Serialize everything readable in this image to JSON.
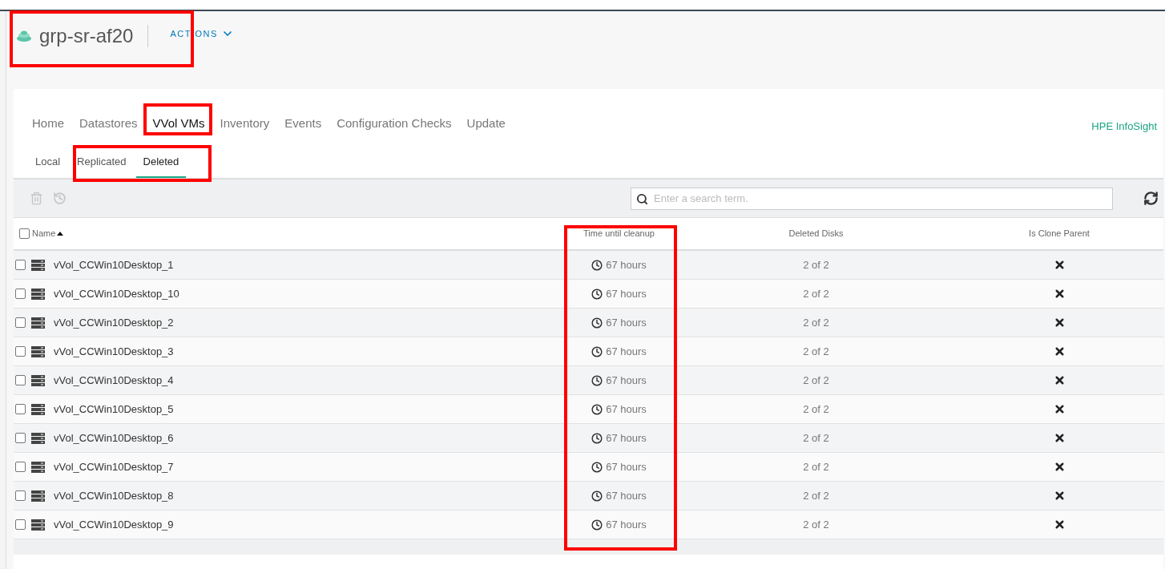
{
  "header": {
    "title": "grp-sr-af20",
    "actions": "ACTIONS"
  },
  "tabs": [
    {
      "label": "Home",
      "selected": false
    },
    {
      "label": "Datastores",
      "selected": false
    },
    {
      "label": "VVol VMs",
      "selected": true
    },
    {
      "label": "Inventory",
      "selected": false
    },
    {
      "label": "Events",
      "selected": false
    },
    {
      "label": "Configuration Checks",
      "selected": false
    },
    {
      "label": "Update",
      "selected": false
    }
  ],
  "infosight_link": "HPE InfoSight",
  "subtabs": [
    {
      "label": "Local",
      "selected": false
    },
    {
      "label": "Replicated",
      "selected": false
    },
    {
      "label": "Deleted",
      "selected": true
    }
  ],
  "search": {
    "placeholder": "Enter a search term."
  },
  "table": {
    "select_all_checked": false,
    "columns": [
      "Name",
      "Time until cleanup",
      "Deleted Disks",
      "Is Clone Parent"
    ],
    "rows": [
      {
        "name": "vVol_CCWin10Desktop_1",
        "time": "67 hours",
        "disks": "2 of 2",
        "is_clone_parent": false,
        "checked": false
      },
      {
        "name": "vVol_CCWin10Desktop_10",
        "time": "67 hours",
        "disks": "2 of 2",
        "is_clone_parent": false,
        "checked": false
      },
      {
        "name": "vVol_CCWin10Desktop_2",
        "time": "67 hours",
        "disks": "2 of 2",
        "is_clone_parent": false,
        "checked": false
      },
      {
        "name": "vVol_CCWin10Desktop_3",
        "time": "67 hours",
        "disks": "2 of 2",
        "is_clone_parent": false,
        "checked": false
      },
      {
        "name": "vVol_CCWin10Desktop_4",
        "time": "67 hours",
        "disks": "2 of 2",
        "is_clone_parent": false,
        "checked": false
      },
      {
        "name": "vVol_CCWin10Desktop_5",
        "time": "67 hours",
        "disks": "2 of 2",
        "is_clone_parent": false,
        "checked": false
      },
      {
        "name": "vVol_CCWin10Desktop_6",
        "time": "67 hours",
        "disks": "2 of 2",
        "is_clone_parent": false,
        "checked": false
      },
      {
        "name": "vVol_CCWin10Desktop_7",
        "time": "67 hours",
        "disks": "2 of 2",
        "is_clone_parent": false,
        "checked": false
      },
      {
        "name": "vVol_CCWin10Desktop_8",
        "time": "67 hours",
        "disks": "2 of 2",
        "is_clone_parent": false,
        "checked": false
      },
      {
        "name": "vVol_CCWin10Desktop_9",
        "time": "67 hours",
        "disks": "2 of 2",
        "is_clone_parent": false,
        "checked": false
      }
    ]
  }
}
